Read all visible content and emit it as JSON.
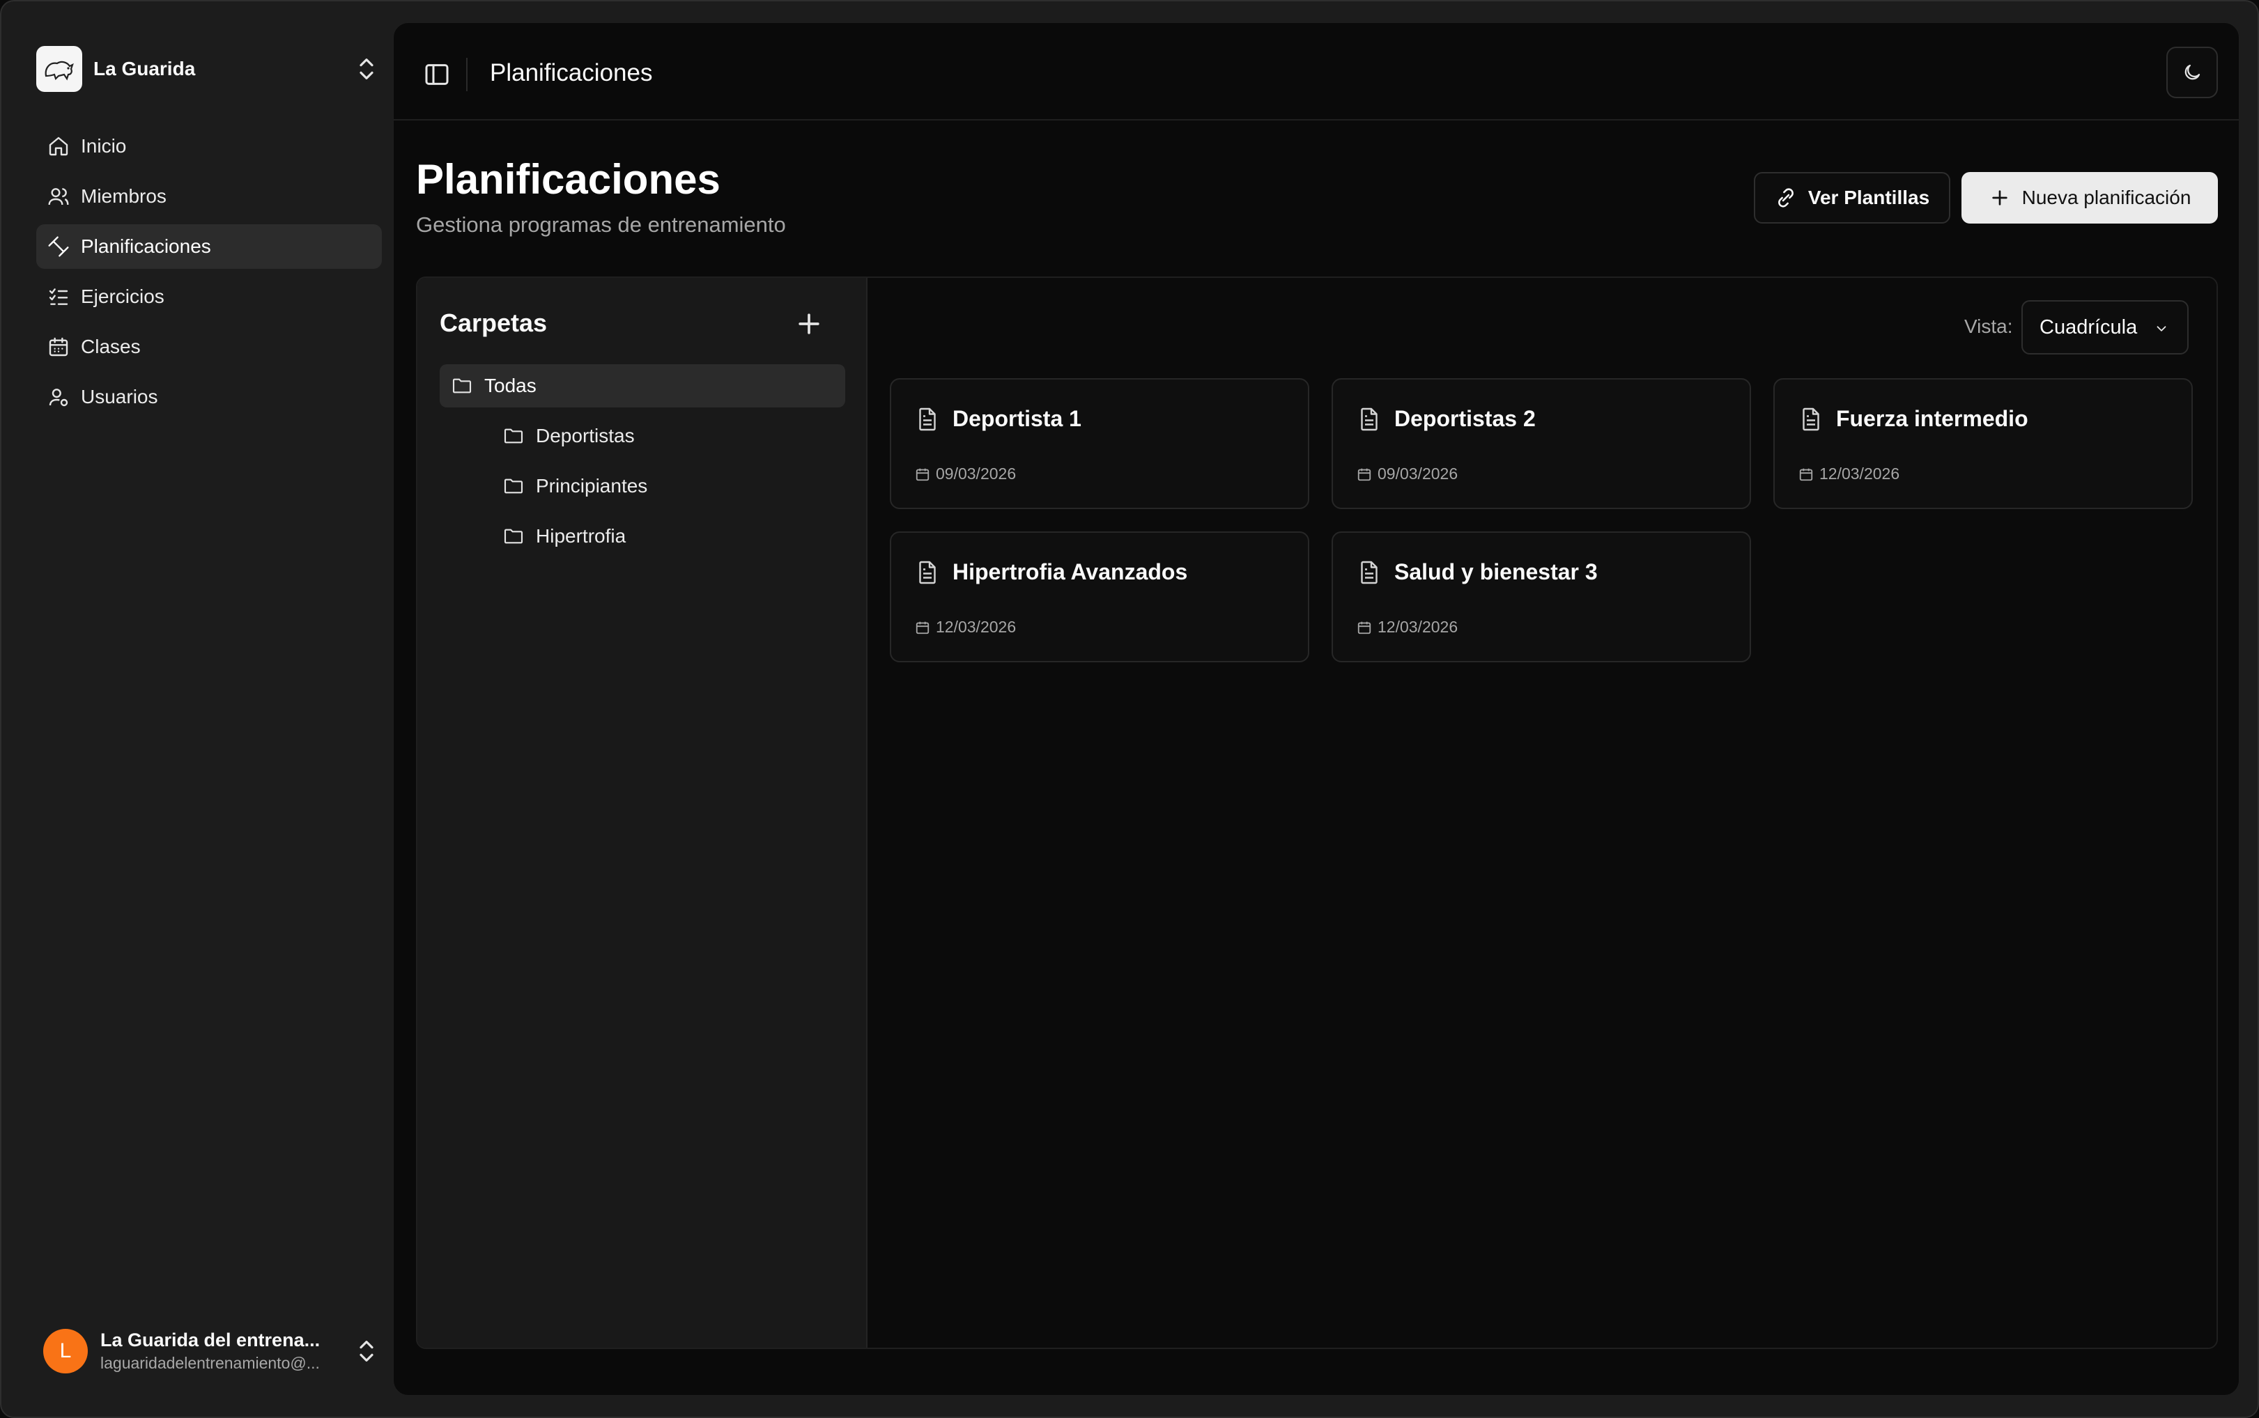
{
  "sidebar": {
    "workspace": "La Guarida",
    "items": [
      {
        "label": "Inicio"
      },
      {
        "label": "Miembros"
      },
      {
        "label": "Planificaciones"
      },
      {
        "label": "Ejercicios"
      },
      {
        "label": "Clases"
      },
      {
        "label": "Usuarios"
      }
    ],
    "user": {
      "initial": "L",
      "name": "La Guarida del entrena...",
      "email": "laguaridadelentrenamiento@..."
    }
  },
  "topbar": {
    "title": "Planificaciones"
  },
  "page": {
    "title": "Planificaciones",
    "subtitle": "Gestiona programas de entrenamiento",
    "templates_button": "Ver Plantillas",
    "new_button": "Nueva planificación"
  },
  "folders": {
    "title": "Carpetas",
    "items": [
      {
        "label": "Todas"
      },
      {
        "label": "Deportistas"
      },
      {
        "label": "Principiantes"
      },
      {
        "label": "Hipertrofia"
      }
    ]
  },
  "view": {
    "label": "Vista:",
    "selected": "Cuadrícula"
  },
  "plans": [
    {
      "title": "Deportista 1",
      "date": "09/03/2026"
    },
    {
      "title": "Deportistas 2",
      "date": "09/03/2026"
    },
    {
      "title": "Fuerza intermedio",
      "date": "12/03/2026"
    },
    {
      "title": "Hipertrofia Avanzados",
      "date": "12/03/2026"
    },
    {
      "title": "Salud y bienestar 3",
      "date": "12/03/2026"
    }
  ],
  "colors": {
    "accent_avatar": "#f97316",
    "primary_button": "#ebebeb",
    "background": "#0a0a0a"
  }
}
